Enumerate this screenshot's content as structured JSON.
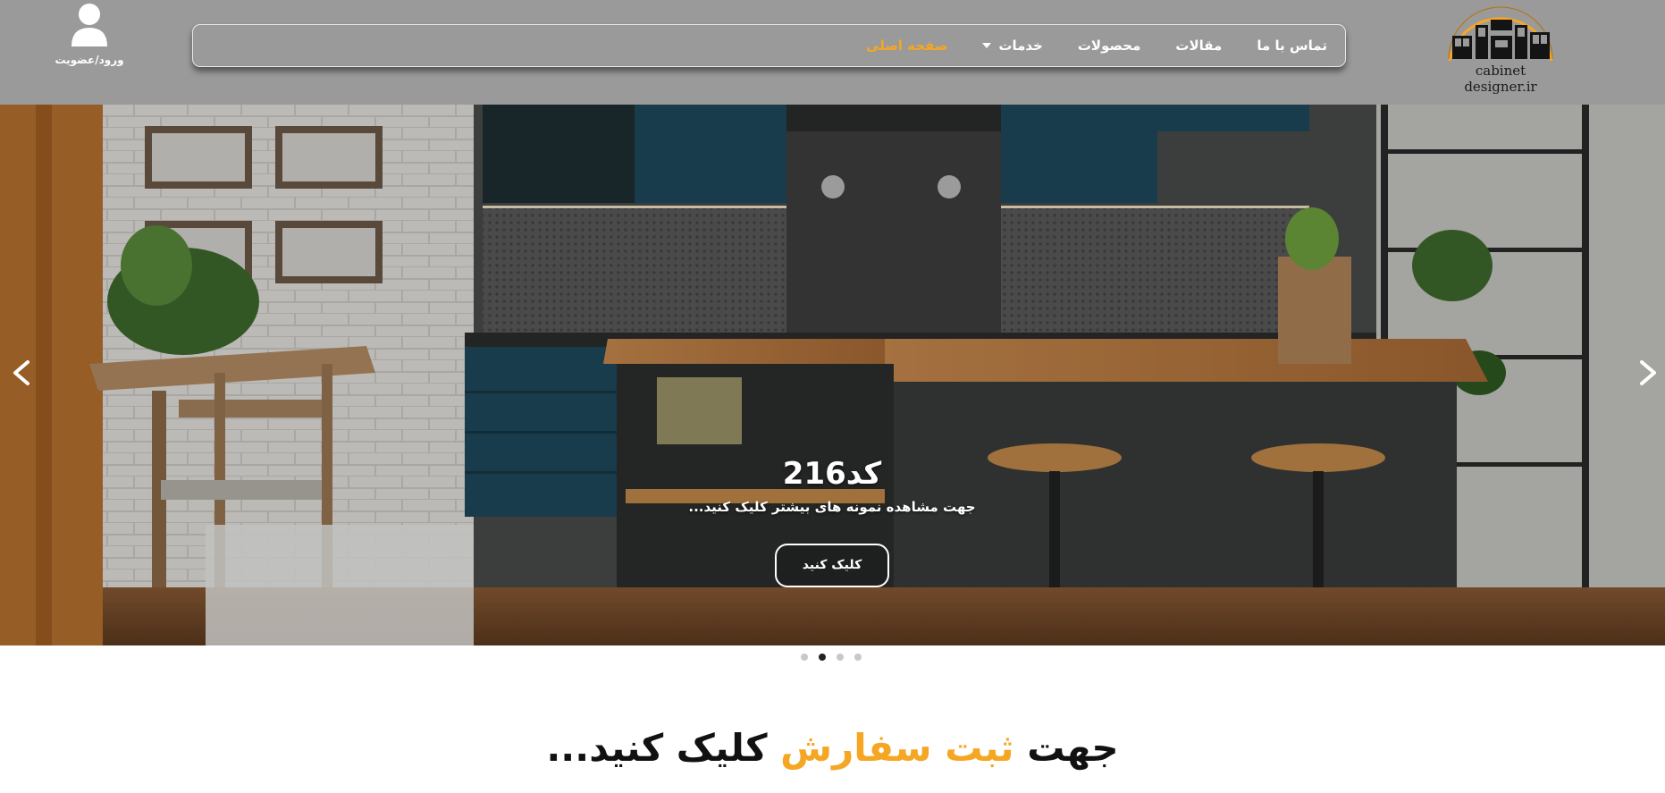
{
  "header": {
    "user": {
      "label": "ورود/عضویت",
      "icon": "user-icon"
    },
    "logo": {
      "text": "cabinet designer.ir",
      "icon": "cabinet-logo-icon"
    },
    "nav": {
      "home": "صفحه اصلی",
      "services": "خدمات",
      "products": "محصولات",
      "articles": "مقالات",
      "contact": "تماس با ما"
    }
  },
  "slider": {
    "title": "کد216",
    "subtitle": "جهت مشاهده نمونه های بیشتر کلیک کنید...",
    "button": "کلیک کنید",
    "slide_count": 4,
    "active_slide": 2
  },
  "cta": {
    "part1": "جهت ",
    "highlight": "ثبت سفارش",
    "part2": " کلیک کنید..."
  },
  "colors": {
    "accent": "#f5a623",
    "header_bg": "#9a9a9a"
  }
}
